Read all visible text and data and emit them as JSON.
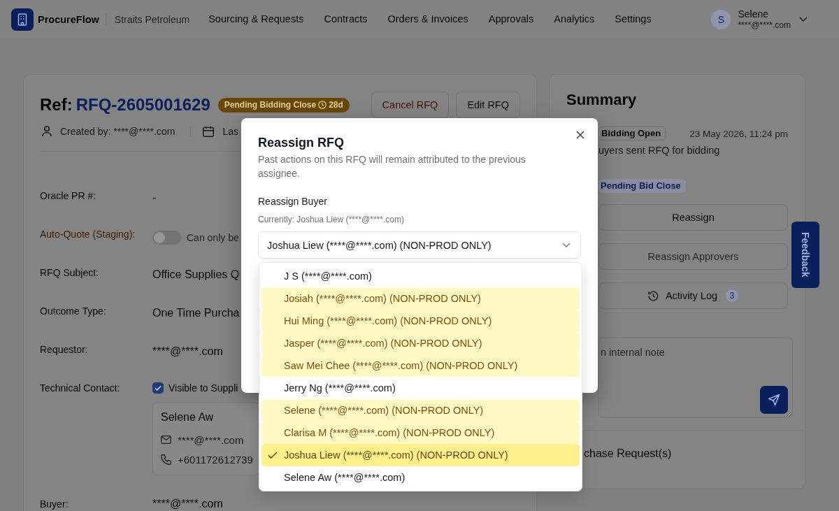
{
  "top_nav": {
    "brand": "ProcureFlow",
    "organization": "Straits Petroleum",
    "items": [
      {
        "label": "Sourcing & Requests",
        "selected": false
      },
      {
        "label": "Contracts",
        "selected": false
      },
      {
        "label": "Orders & Invoices",
        "selected": false
      },
      {
        "label": "Approvals",
        "selected": false
      },
      {
        "label": "Analytics",
        "selected": false
      },
      {
        "label": "Settings",
        "selected": false
      }
    ],
    "user": {
      "initial": "S",
      "name": "Selene",
      "email": "****@****.com"
    }
  },
  "rfq": {
    "ref_label": "Ref:",
    "ref_number": "RFQ-2605001629",
    "status_badge": {
      "label": "Pending Bidding Close",
      "countdown": "28d"
    },
    "actions": [
      {
        "label": "Cancel RFQ",
        "kind": "danger"
      },
      {
        "label": "Edit RFQ",
        "kind": "default"
      }
    ],
    "meta": {
      "created_by": "Created by: ****@****.com",
      "last_updated": "Las"
    },
    "fields": [
      {
        "kind": "text",
        "label": "Oracle PR #:",
        "value": "-"
      },
      {
        "kind": "toggle",
        "label": "Auto-Quote (Staging):",
        "on": false,
        "note": "Can only be"
      },
      {
        "kind": "text",
        "label": "RFQ Subject:",
        "value": "Office Supplies Q"
      },
      {
        "kind": "text",
        "label": "Outcome Type:",
        "value": "One Time Purcha"
      },
      {
        "kind": "text",
        "label": "Requestor:",
        "value": "****@****.com"
      },
      {
        "kind": "contact",
        "label": "Technical Contact:",
        "checked": true,
        "checkbox_label": "Visible to Suppli",
        "contact": {
          "name": "Selene Aw",
          "email": "****@****.com",
          "phone": "+601172612739"
        }
      },
      {
        "kind": "text",
        "label": "Buyer:",
        "value": "****@****.com"
      }
    ]
  },
  "summary": {
    "title": "Summary",
    "timeline": [
      {
        "status": "Bidding Open",
        "time": "23 May 2026, 11:24 pm",
        "description": "uyers sent RFQ for bidding"
      }
    ],
    "stage": "Pending Bid Close",
    "actions": [
      {
        "label": "Reassign",
        "kind": "plain",
        "disabled": false
      },
      {
        "label": "Reassign Approvers",
        "kind": "plain",
        "disabled": true
      },
      {
        "label": "Activity Log",
        "kind": "log",
        "disabled": false,
        "count": "3"
      }
    ],
    "note": {
      "placeholder": "n internal note"
    },
    "section_title": "chase Request(s)"
  },
  "feedback_tab": "Feedback",
  "modal": {
    "title": "Reassign RFQ",
    "description": "Past actions on this RFQ will remain attributed to the previous assignee.",
    "field_label": "Reassign Buyer",
    "current": "Currently: Joshua Liew (****@****.com)",
    "select_value": "Joshua Liew (****@****.com) (NON-PROD ONLY)",
    "expanded": true,
    "options": [
      {
        "label": "J S (****@****.com)",
        "kind": "standard",
        "selected": false
      },
      {
        "label": "Josiah (****@****.com) (NON-PROD ONLY)",
        "kind": "non_prod",
        "selected": false
      },
      {
        "label": "Hui Ming (****@****.com) (NON-PROD ONLY)",
        "kind": "non_prod",
        "selected": false
      },
      {
        "label": "Jasper (****@****.com) (NON-PROD ONLY)",
        "kind": "non_prod",
        "selected": false
      },
      {
        "label": "Saw Mei Chee (****@****.com) (NON-PROD ONLY)",
        "kind": "non_prod",
        "selected": false
      },
      {
        "label": "Jerry Ng (****@****.com)",
        "kind": "standard",
        "selected": false
      },
      {
        "label": "Selene (****@****.com) (NON-PROD ONLY)",
        "kind": "non_prod",
        "selected": false
      },
      {
        "label": "Clarisa M (****@****.com) (NON-PROD ONLY)",
        "kind": "non_prod",
        "selected": false
      },
      {
        "label": "Joshua Liew (****@****.com) (NON-PROD ONLY)",
        "kind": "non_prod",
        "selected": true
      },
      {
        "label": "Selene Aw (****@****.com)",
        "kind": "standard",
        "selected": false
      }
    ]
  }
}
